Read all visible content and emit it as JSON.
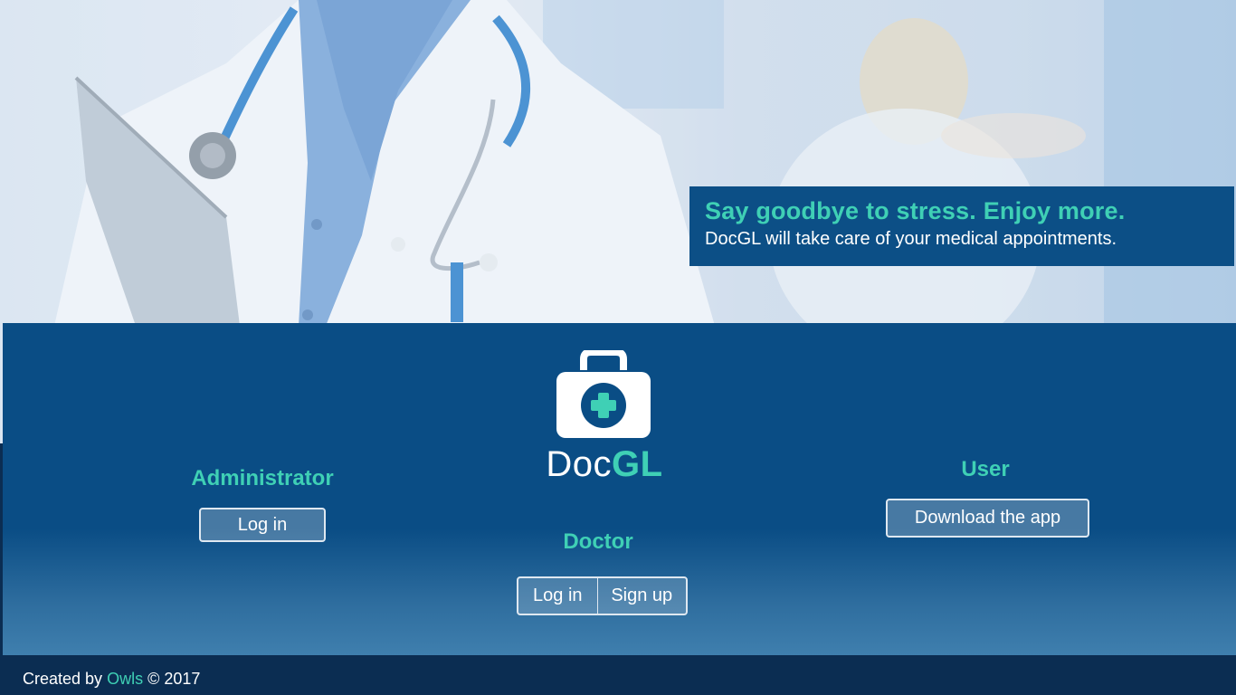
{
  "hero": {
    "title": "Say goodbye to stress. Enjoy more.",
    "subtitle": "DocGL will take care of your medical appointments."
  },
  "brand": {
    "part1": "Doc",
    "part2": "GL",
    "logo_icon": "medical-kit-icon"
  },
  "administrator": {
    "title": "Administrator",
    "login_label": "Log in"
  },
  "doctor": {
    "title": "Doctor",
    "login_label": "Log in",
    "signup_label": "Sign up"
  },
  "user": {
    "title": "User",
    "download_label": "Download the app"
  },
  "footer": {
    "prefix": "Created by",
    "link": "Owls",
    "suffix": "© 2017"
  },
  "colors": {
    "accent": "#3fd0b5",
    "panel": "#0a4d85",
    "footer": "#0b2d52"
  }
}
